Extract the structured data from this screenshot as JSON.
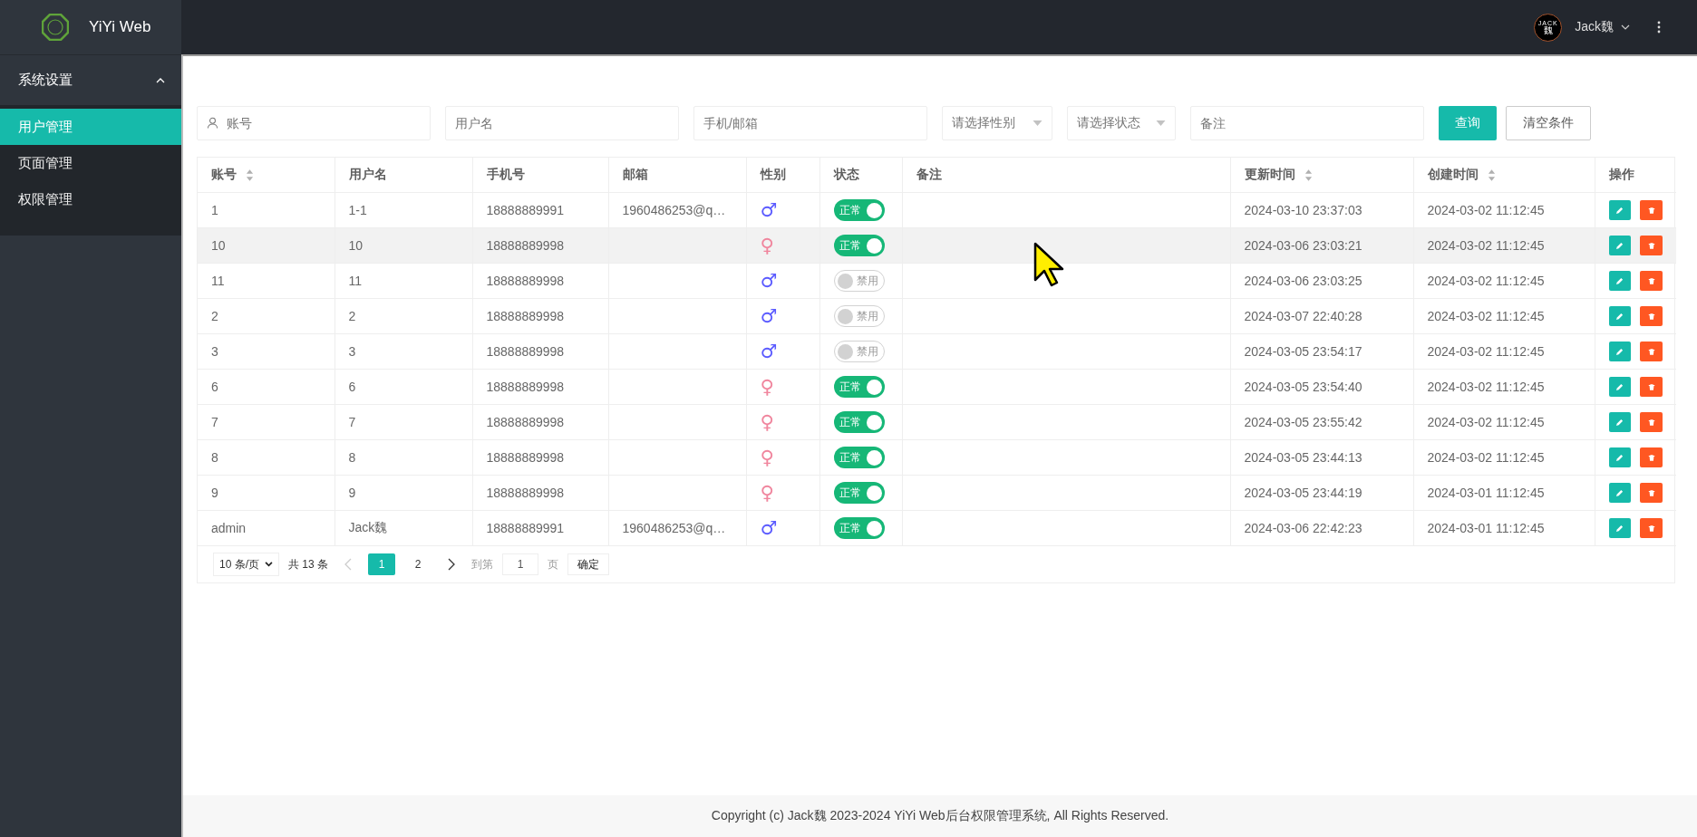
{
  "brand": {
    "title": "YiYi Web"
  },
  "user": {
    "avatar_lines": [
      "JACK",
      "魏"
    ],
    "name": "Jack魏"
  },
  "sidebar": {
    "group": {
      "label": "系统设置",
      "expanded": true
    },
    "items": [
      {
        "label": "用户管理",
        "selected": true
      },
      {
        "label": "页面管理",
        "selected": false
      },
      {
        "label": "权限管理",
        "selected": false
      }
    ]
  },
  "search": {
    "account": {
      "placeholder": "账号"
    },
    "username": {
      "placeholder": "用户名"
    },
    "contact": {
      "placeholder": "手机/邮箱"
    },
    "gender": {
      "placeholder": "请选择性别"
    },
    "status": {
      "placeholder": "请选择状态"
    },
    "remark": {
      "placeholder": "备注"
    },
    "buttons": [
      "查询",
      "清空条件"
    ]
  },
  "table": {
    "columns": [
      {
        "label": "账号",
        "sortable": true
      },
      {
        "label": "用户名",
        "sortable": false
      },
      {
        "label": "手机号",
        "sortable": false
      },
      {
        "label": "邮箱",
        "sortable": false
      },
      {
        "label": "性别",
        "sortable": false
      },
      {
        "label": "状态",
        "sortable": false
      },
      {
        "label": "备注",
        "sortable": false
      },
      {
        "label": "更新时间",
        "sortable": true
      },
      {
        "label": "创建时间",
        "sortable": true
      },
      {
        "label": "操作",
        "sortable": false
      }
    ],
    "rows": [
      {
        "account": "1",
        "username": "1-1",
        "phone": "18888889991",
        "email": "1960486253@q…",
        "gender": {
          "symbol": "♂",
          "color": "#5b5bff"
        },
        "status": {
          "label": "正常",
          "on": true
        },
        "updated": "2024-03-10 23:37:03",
        "created": "2024-03-02 11:12:45",
        "highlighted": false
      },
      {
        "account": "10",
        "username": "10",
        "phone": "18888889998",
        "gender": {
          "symbol": "♀",
          "color": "#f0859d"
        },
        "status": {
          "label": "正常",
          "on": true
        },
        "updated": "2024-03-06 23:03:21",
        "created": "2024-03-02 11:12:45",
        "highlighted": true
      },
      {
        "account": "11",
        "username": "11",
        "phone": "18888889998",
        "gender": {
          "symbol": "♂",
          "color": "#5b5bff"
        },
        "status": {
          "label": "禁用",
          "on": false
        },
        "updated": "2024-03-06 23:03:25",
        "created": "2024-03-02 11:12:45",
        "highlighted": false
      },
      {
        "account": "2",
        "username": "2",
        "phone": "18888889998",
        "gender": {
          "symbol": "♂",
          "color": "#5b5bff"
        },
        "status": {
          "label": "禁用",
          "on": false
        },
        "updated": "2024-03-07 22:40:28",
        "created": "2024-03-02 11:12:45",
        "highlighted": false
      },
      {
        "account": "3",
        "username": "3",
        "phone": "18888889998",
        "gender": {
          "symbol": "♂",
          "color": "#5b5bff"
        },
        "status": {
          "label": "禁用",
          "on": false
        },
        "updated": "2024-03-05 23:54:17",
        "created": "2024-03-02 11:12:45",
        "highlighted": false
      },
      {
        "account": "6",
        "username": "6",
        "phone": "18888889998",
        "gender": {
          "symbol": "♀",
          "color": "#f0859d"
        },
        "status": {
          "label": "正常",
          "on": true
        },
        "updated": "2024-03-05 23:54:40",
        "created": "2024-03-02 11:12:45",
        "highlighted": false
      },
      {
        "account": "7",
        "username": "7",
        "phone": "18888889998",
        "gender": {
          "symbol": "♀",
          "color": "#f0859d"
        },
        "status": {
          "label": "正常",
          "on": true
        },
        "updated": "2024-03-05 23:55:42",
        "created": "2024-03-02 11:12:45",
        "highlighted": false
      },
      {
        "account": "8",
        "username": "8",
        "phone": "18888889998",
        "gender": {
          "symbol": "♀",
          "color": "#f0859d"
        },
        "status": {
          "label": "正常",
          "on": true
        },
        "updated": "2024-03-05 23:44:13",
        "created": "2024-03-02 11:12:45",
        "highlighted": false
      },
      {
        "account": "9",
        "username": "9",
        "phone": "18888889998",
        "gender": {
          "symbol": "♀",
          "color": "#f0859d"
        },
        "status": {
          "label": "正常",
          "on": true
        },
        "updated": "2024-03-05 23:44:19",
        "created": "2024-03-01 11:12:45",
        "highlighted": false
      },
      {
        "account": "admin",
        "username": "Jack魏",
        "phone": "18888889991",
        "email": "1960486253@q…",
        "gender": {
          "symbol": "♂",
          "color": "#5b5bff"
        },
        "status": {
          "label": "正常",
          "on": true
        },
        "updated": "2024-03-06 22:42:23",
        "created": "2024-03-01 11:12:45",
        "highlighted": false
      }
    ]
  },
  "pagination": {
    "page_size": "10 条/页",
    "total": "共 13 条",
    "pages": [
      {
        "label": "1",
        "selected": true
      },
      {
        "label": "2",
        "selected": false
      }
    ],
    "prev_disabled": true,
    "goto_label": "到第",
    "goto_value": "1",
    "page_unit": "页",
    "confirm": "确定"
  },
  "footer": {
    "text": "Copyright (c) Jack魏 2023-2024 YiYi Web后台权限管理系统, All Rights Reserved."
  }
}
